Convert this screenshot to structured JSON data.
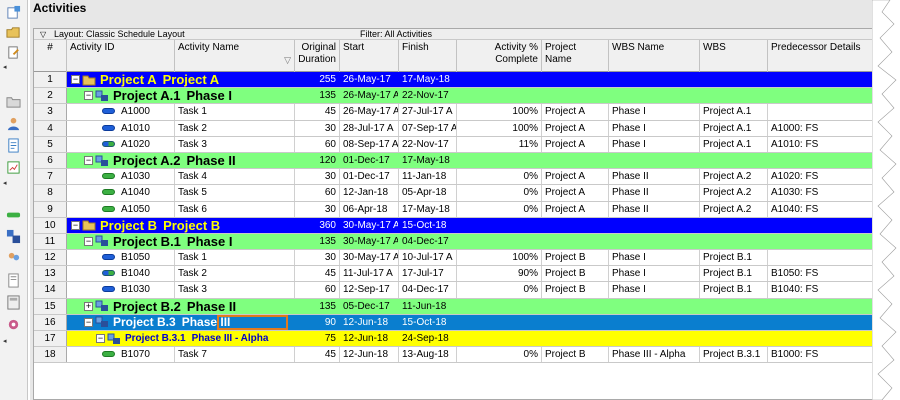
{
  "panel_title": "Activities",
  "grid_bar": {
    "layout_label": "Layout: Classic Schedule Layout",
    "filter_label": "Filter: All Activities"
  },
  "columns": {
    "num": "#",
    "activity_id": "Activity ID",
    "activity_name": "Activity Name",
    "original_duration": "Original Duration",
    "start": "Start",
    "finish": "Finish",
    "pct_complete": "Activity % Complete",
    "project_name": "Project Name",
    "wbs_name": "WBS Name",
    "wbs": "WBS",
    "predecessor": "Predecessor Details"
  },
  "rows": [
    {
      "num": "1",
      "kind": "project",
      "id": "Project A",
      "name": "Project A",
      "duration": "255",
      "start": "26-May-17",
      "finish": "17-May-18",
      "pct": "",
      "project_name": "",
      "wbs_name": "",
      "wbs": "",
      "pred": ""
    },
    {
      "num": "2",
      "kind": "wbs",
      "id": "Project A.1",
      "name": "Phase I",
      "duration": "135",
      "start": "26-May-17 A",
      "finish": "22-Nov-17",
      "pct": "",
      "project_name": "",
      "wbs_name": "",
      "wbs": "",
      "pred": ""
    },
    {
      "num": "3",
      "kind": "activity",
      "status": "complete",
      "id": "A1000",
      "name": "Task 1",
      "duration": "45",
      "start": "26-May-17 A",
      "finish": "27-Jul-17 A",
      "pct": "100%",
      "project_name": "Project A",
      "wbs_name": "Phase I",
      "wbs": "Project A.1",
      "pred": ""
    },
    {
      "num": "4",
      "kind": "activity",
      "status": "complete",
      "id": "A1010",
      "name": "Task 2",
      "duration": "30",
      "start": "28-Jul-17 A",
      "finish": "07-Sep-17 A",
      "pct": "100%",
      "project_name": "Project A",
      "wbs_name": "Phase I",
      "wbs": "Project A.1",
      "pred": "A1000: FS"
    },
    {
      "num": "5",
      "kind": "activity",
      "status": "inprogress",
      "id": "A1020",
      "name": "Task 3",
      "duration": "60",
      "start": "08-Sep-17 A",
      "finish": "22-Nov-17",
      "pct": "11%",
      "project_name": "Project A",
      "wbs_name": "Phase I",
      "wbs": "Project A.1",
      "pred": "A1010: FS"
    },
    {
      "num": "6",
      "kind": "wbs",
      "id": "Project A.2",
      "name": "Phase II",
      "duration": "120",
      "start": "01-Dec-17",
      "finish": "17-May-18",
      "pct": "",
      "project_name": "",
      "wbs_name": "",
      "wbs": "",
      "pred": ""
    },
    {
      "num": "7",
      "kind": "activity",
      "status": "notstarted",
      "id": "A1030",
      "name": "Task 4",
      "duration": "30",
      "start": "01-Dec-17",
      "finish": "11-Jan-18",
      "pct": "0%",
      "project_name": "Project A",
      "wbs_name": "Phase II",
      "wbs": "Project A.2",
      "pred": "A1020: FS"
    },
    {
      "num": "8",
      "kind": "activity",
      "status": "notstarted",
      "id": "A1040",
      "name": "Task 5",
      "duration": "60",
      "start": "12-Jan-18",
      "finish": "05-Apr-18",
      "pct": "0%",
      "project_name": "Project A",
      "wbs_name": "Phase II",
      "wbs": "Project A.2",
      "pred": "A1030: FS"
    },
    {
      "num": "9",
      "kind": "activity",
      "status": "notstarted",
      "id": "A1050",
      "name": "Task 6",
      "duration": "30",
      "start": "06-Apr-18",
      "finish": "17-May-18",
      "pct": "0%",
      "project_name": "Project A",
      "wbs_name": "Phase II",
      "wbs": "Project A.2",
      "pred": "A1040: FS"
    },
    {
      "num": "10",
      "kind": "project",
      "id": "Project B",
      "name": "Project B",
      "duration": "360",
      "start": "30-May-17 A",
      "finish": "15-Oct-18",
      "pct": "",
      "project_name": "",
      "wbs_name": "",
      "wbs": "",
      "pred": ""
    },
    {
      "num": "11",
      "kind": "wbs",
      "id": "Project B.1",
      "name": "Phase I",
      "duration": "135",
      "start": "30-May-17 A",
      "finish": "04-Dec-17",
      "pct": "",
      "project_name": "",
      "wbs_name": "",
      "wbs": "",
      "pred": ""
    },
    {
      "num": "12",
      "kind": "activity",
      "status": "complete",
      "id": "B1050",
      "name": "Task 1",
      "duration": "30",
      "start": "30-May-17 A",
      "finish": "10-Jul-17 A",
      "pct": "100%",
      "project_name": "Project B",
      "wbs_name": "Phase I",
      "wbs": "Project B.1",
      "pred": ""
    },
    {
      "num": "13",
      "kind": "activity",
      "status": "inprogress",
      "id": "B1040",
      "name": "Task 2",
      "duration": "45",
      "start": "11-Jul-17 A",
      "finish": "17-Jul-17",
      "pct": "90%",
      "project_name": "Project B",
      "wbs_name": "Phase I",
      "wbs": "Project B.1",
      "pred": "B1050: FS"
    },
    {
      "num": "14",
      "kind": "activity",
      "status": "complete",
      "id": "B1030",
      "name": "Task 3",
      "duration": "60",
      "start": "12-Sep-17",
      "finish": "04-Dec-17",
      "pct": "0%",
      "project_name": "Project B",
      "wbs_name": "Phase I",
      "wbs": "Project B.1",
      "pred": "B1040: FS"
    },
    {
      "num": "15",
      "kind": "wbs",
      "collapsed": true,
      "id": "Project B.2",
      "name": "Phase II",
      "duration": "135",
      "start": "05-Dec-17",
      "finish": "11-Jun-18",
      "pct": "",
      "project_name": "",
      "wbs_name": "",
      "wbs": "",
      "pred": ""
    },
    {
      "num": "16",
      "kind": "selected",
      "id": "Project B.3",
      "name": "Phase III",
      "duration": "90",
      "start": "12-Jun-18",
      "finish": "15-Oct-18",
      "pct": "",
      "project_name": "",
      "wbs_name": "",
      "wbs": "",
      "pred": ""
    },
    {
      "num": "17",
      "kind": "sub",
      "id": "Project B.3.1",
      "name": "Phase III - Alpha",
      "duration": "75",
      "start": "12-Jun-18",
      "finish": "24-Sep-18",
      "pct": "",
      "project_name": "",
      "wbs_name": "",
      "wbs": "",
      "pred": ""
    },
    {
      "num": "18",
      "kind": "activity",
      "status": "notstarted",
      "id": "B1070",
      "name": "Task 7",
      "duration": "45",
      "start": "12-Jun-18",
      "finish": "13-Aug-18",
      "pct": "0%",
      "project_name": "Project B",
      "wbs_name": "Phase III - Alpha",
      "wbs": "Project B.3.1",
      "pred": "B1000: FS"
    }
  ],
  "colors": {
    "project_row": "#0000ff",
    "wbs_row": "#7fff7f",
    "selected_row": "#0a7ecf",
    "sub_wbs_row": "#ffff00",
    "highlight_border": "#e07a1e"
  }
}
